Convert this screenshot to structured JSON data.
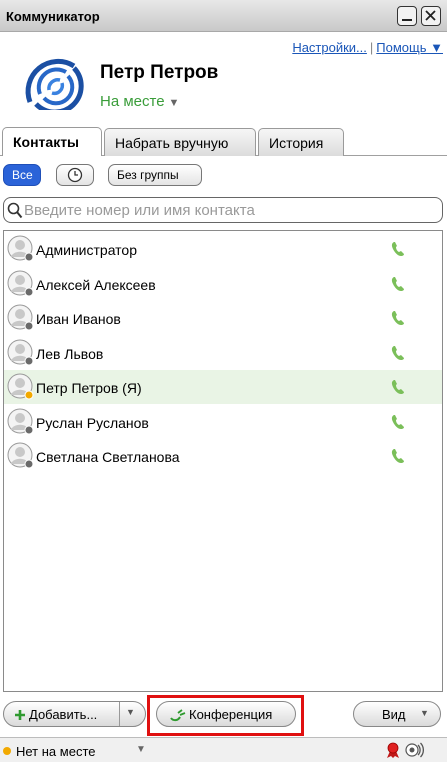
{
  "window": {
    "title": "Коммуникатор"
  },
  "header": {
    "settings_link": "Настройки...",
    "help_link": "Помощь ▼",
    "user_name": "Петр Петров",
    "presence": "На месте"
  },
  "tabs": [
    {
      "label": "Контакты",
      "active": true
    },
    {
      "label": "Набрать вручную",
      "active": false
    },
    {
      "label": "История",
      "active": false
    }
  ],
  "filters": {
    "all": "Все",
    "recent_icon": "clock-icon",
    "no_group": "Без группы"
  },
  "search": {
    "placeholder": "Введите номер или имя контакта",
    "value": ""
  },
  "contacts": [
    {
      "name": "Администратор",
      "status": "offline"
    },
    {
      "name": "Алексей Алексеев",
      "status": "offline"
    },
    {
      "name": "Иван Иванов",
      "status": "offline"
    },
    {
      "name": "Лев Львов",
      "status": "offline"
    },
    {
      "name": "Петр Петров (Я)",
      "status": "away",
      "self": true
    },
    {
      "name": "Руслан Русланов",
      "status": "offline"
    },
    {
      "name": "Светлана Светланова",
      "status": "offline"
    }
  ],
  "toolbar": {
    "add": "Добавить...",
    "conference": "Конференция",
    "view": "Вид"
  },
  "statusbar": {
    "status": "Нет на месте"
  },
  "colors": {
    "online": "#3a9d3a",
    "away": "#f2a900",
    "accent": "#2b63d8",
    "highlight": "#e01010"
  }
}
